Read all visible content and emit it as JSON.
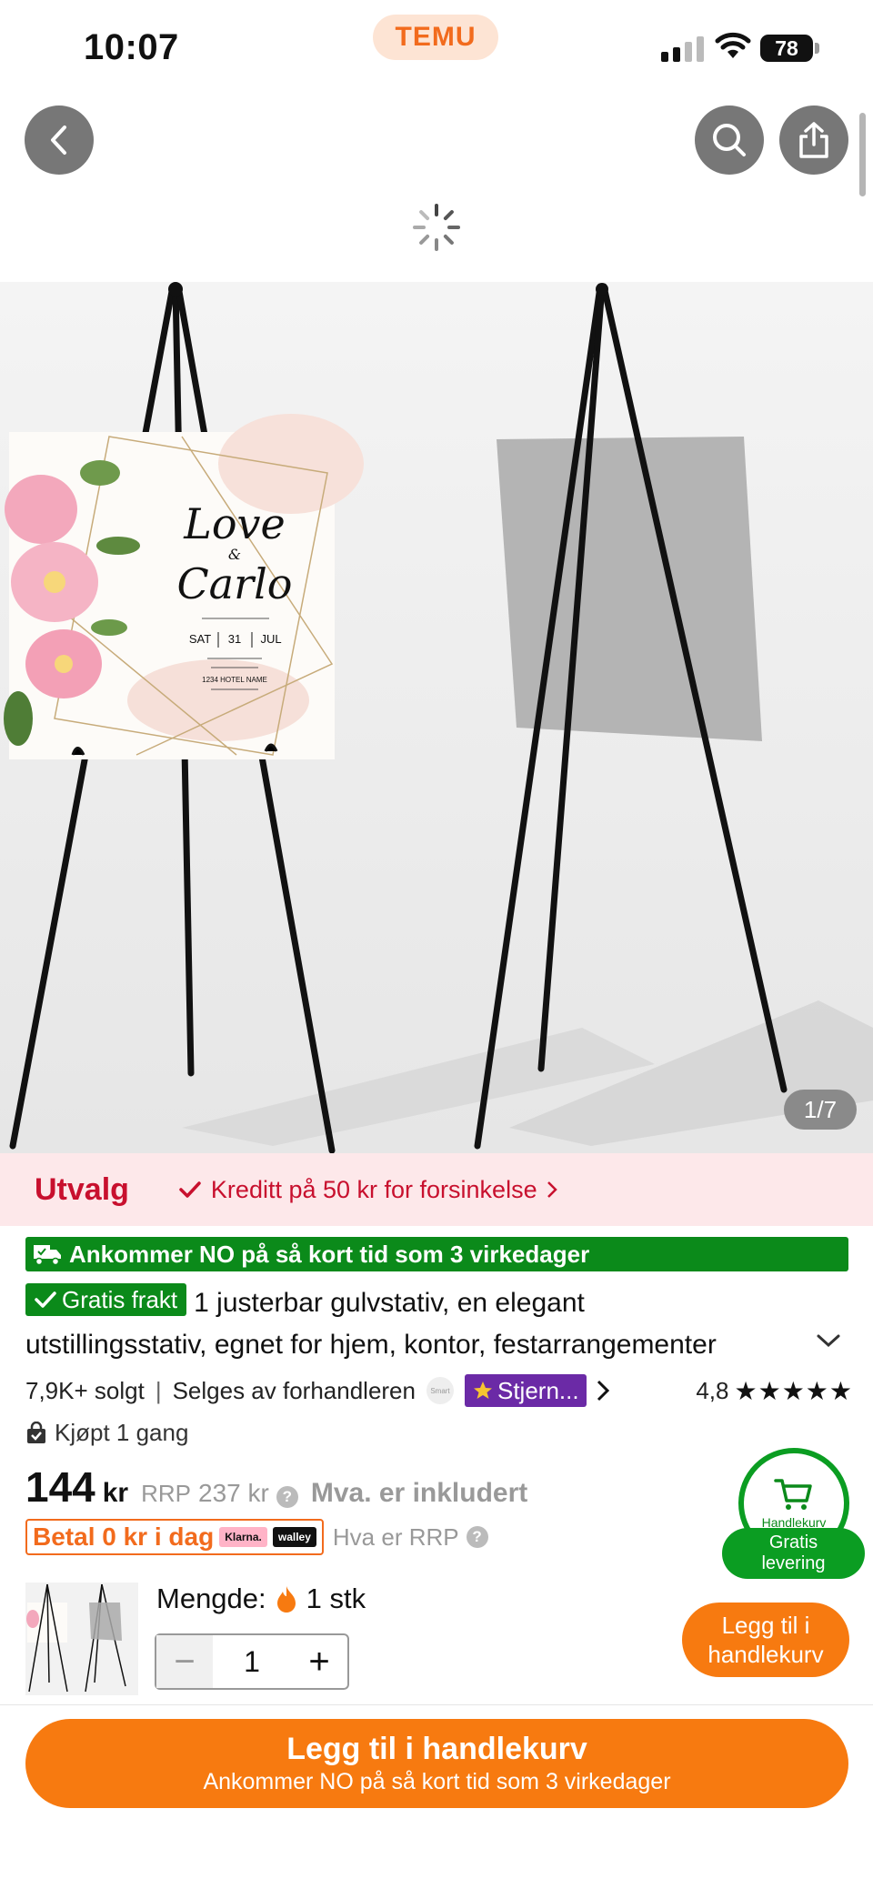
{
  "status_bar": {
    "time": "10:07",
    "app_badge": "TEMU",
    "battery": "78"
  },
  "gallery": {
    "counter": "1/7",
    "invitation": {
      "line1": "Love",
      "amp": "&",
      "line2": "Carlo",
      "day": "SAT",
      "date": "31",
      "month": "JUL",
      "venue": "1234 HOTEL NAME"
    }
  },
  "promo": {
    "tag": "Utvalg",
    "credit_text": "Kreditt på 50 kr for forsinkelse"
  },
  "arrival_banner": "Ankommer NO på så kort tid som 3 virkedager",
  "product": {
    "free_shipping_badge": "Gratis frakt",
    "title_line1": "1 justerbar gulvstativ, en elegant",
    "title_line2": "utstillingsstativ, egnet for hjem, kontor, festarrangementer",
    "sold": "7,9K+ solgt",
    "separator": "|",
    "sold_by": "Selges av forhandleren",
    "seller_logo": "Smart",
    "star_seller": "Stjern...",
    "rating": "4,8",
    "stars": "★★★★★",
    "bought": "Kjøpt 1 gang"
  },
  "price": {
    "amount": "144",
    "unit": "kr",
    "rrp_label": "RRP",
    "rrp_value": "237 kr",
    "vat_note": "Mva. er inkludert",
    "pay_later": "Betal 0 kr i dag",
    "klarna": "Klarna.",
    "walley": "walley",
    "rrp_question": "Hva er RRP"
  },
  "cart_widget": {
    "label": "Handlekurv",
    "free_line1": "Gratis",
    "free_line2": "levering"
  },
  "quantity": {
    "label": "Mengde:",
    "stock": "1 stk",
    "value": "1",
    "minus": "−",
    "plus": "+"
  },
  "actions": {
    "add_small_line1": "Legg til i",
    "add_small_line2": "handlekurv",
    "add_big_title": "Legg til i handlekurv",
    "add_big_sub": "Ankommer NO på så kort tid som 3 virkedager"
  },
  "colors": {
    "brand_orange": "#f77a10",
    "promo_red": "#c8102e",
    "ship_green": "#0b8a1a",
    "star_purple": "#6b2aa6"
  }
}
